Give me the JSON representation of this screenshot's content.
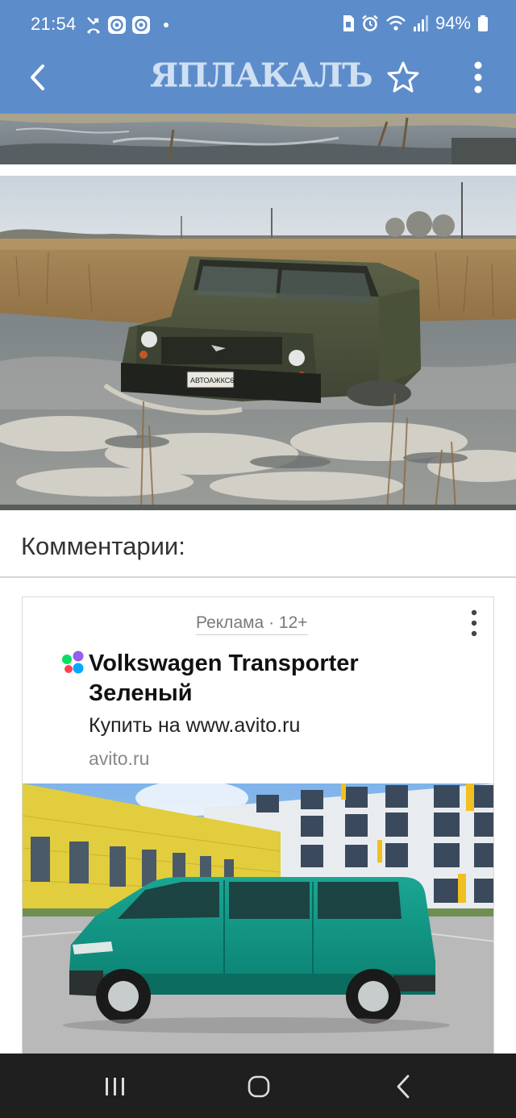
{
  "status_bar": {
    "time": "21:54",
    "battery_text": "94%",
    "icons": [
      "missed-call-icon",
      "app-notification-icon",
      "app-notification-icon",
      "dot-icon",
      "sim-icon",
      "alarm-icon",
      "wifi-icon",
      "signal-icon",
      "battery-icon"
    ]
  },
  "app_bar": {
    "logo_text": "ЯПЛАКАЛЪ",
    "back_icon": "chevron-left-icon",
    "favorite_icon": "star-outline-icon",
    "menu_icon": "more-vertical-icon",
    "bar_color": "#5d8ccb"
  },
  "post": {
    "image_top": "photo-flooded-field",
    "image_main": "photo-uaz-in-water",
    "plate_text": "АВТОАЖКС66"
  },
  "comments": {
    "title": "Комментарии:"
  },
  "ad": {
    "tag": "Реклама · 12+",
    "title": "Volkswagen Transporter Зеленый",
    "description": "Купить на www.avito.ru",
    "domain": "avito.ru",
    "image": "photo-green-van"
  },
  "nav_bar": {
    "recent_icon": "recent-apps-icon",
    "home_icon": "home-icon",
    "back_icon": "back-icon"
  }
}
